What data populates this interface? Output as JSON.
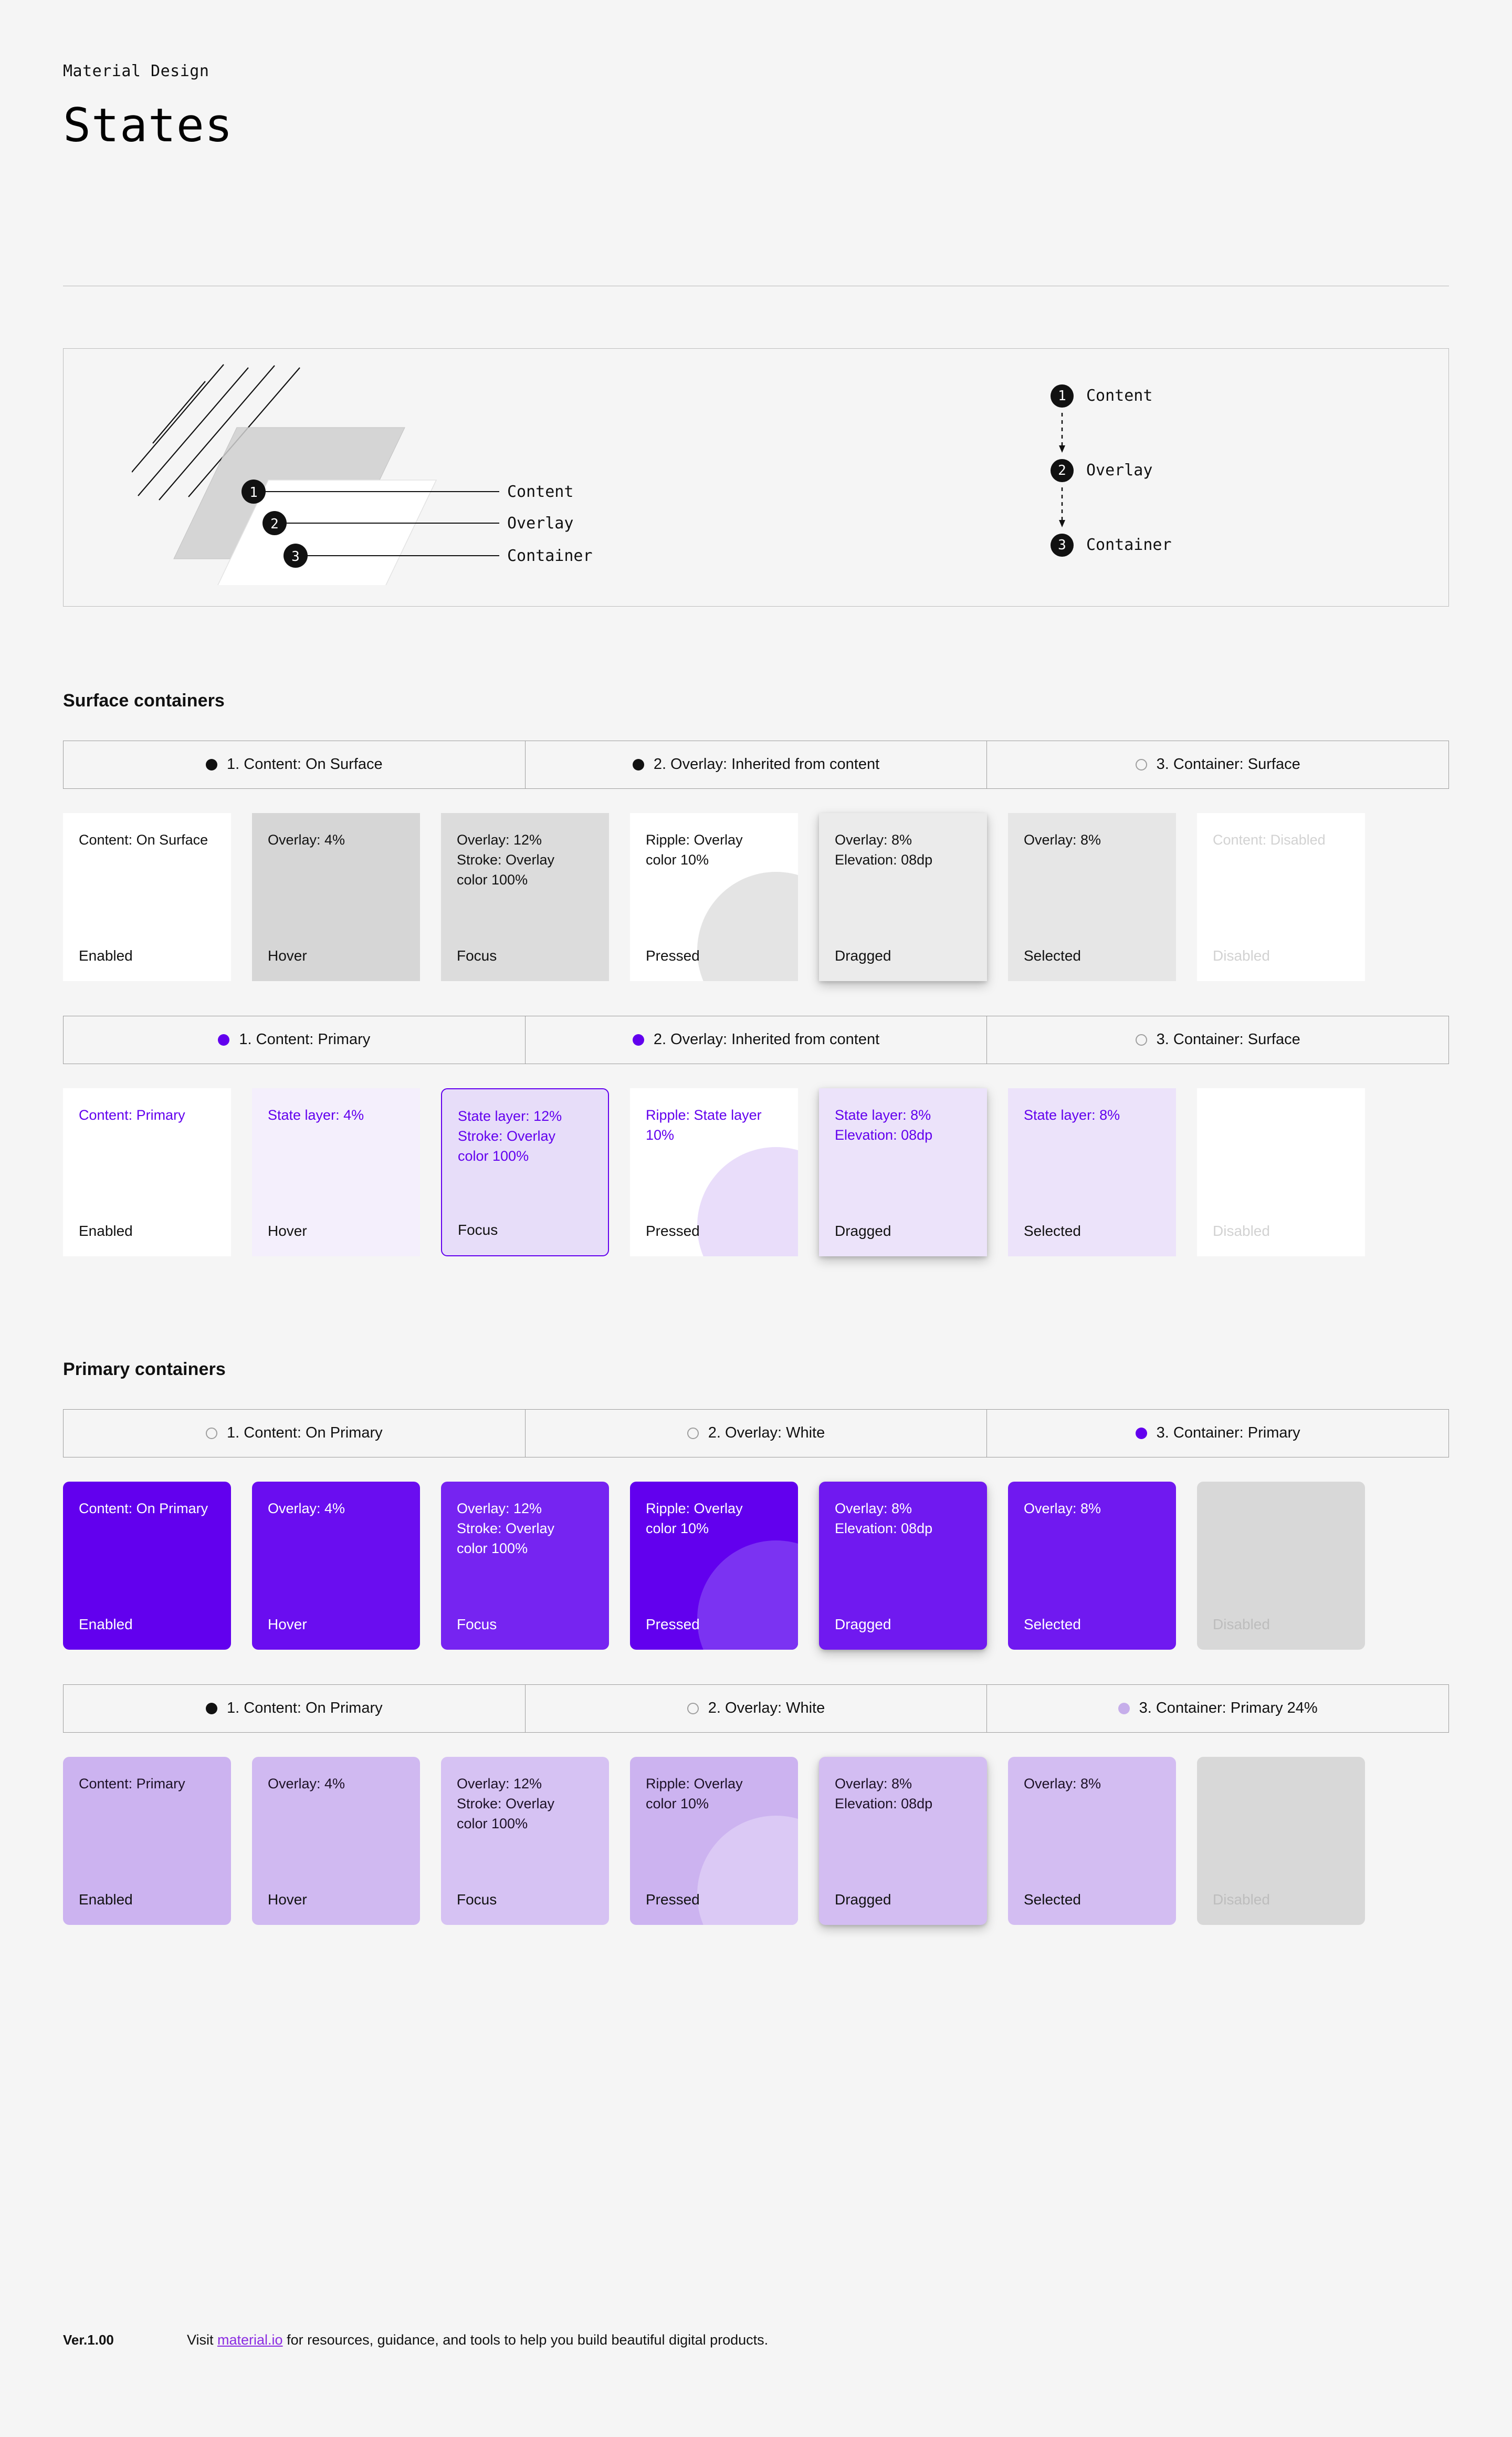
{
  "header": {
    "eyebrow": "Material Design",
    "title": "States"
  },
  "diagram": {
    "callouts": [
      {
        "num": "1",
        "label": "Content"
      },
      {
        "num": "2",
        "label": "Overlay"
      },
      {
        "num": "3",
        "label": "Container"
      }
    ],
    "legend": [
      {
        "num": "1",
        "label": "Content"
      },
      {
        "num": "2",
        "label": "Overlay"
      },
      {
        "num": "3",
        "label": "Container"
      }
    ]
  },
  "colors": {
    "primary": "#6200EE",
    "primary_dot": "#6200EE",
    "primary_24": "#C6AEEA",
    "on_surface_dot": "#111111",
    "hollow_dot_border": "#9e9e9e",
    "link": "#8a2be2"
  },
  "sections": [
    {
      "heading": "Surface containers",
      "rows": [
        {
          "legend": [
            {
              "dot": "filled-black",
              "text": "1. Content: On Surface"
            },
            {
              "dot": "filled-black",
              "text": "2. Overlay: Inherited from content"
            },
            {
              "dot": "hollow",
              "text": "3. Container: Surface"
            }
          ],
          "cards": [
            {
              "desc": "Content: On Surface",
              "state": "Enabled",
              "bg": "#ffffff",
              "text": "#111111",
              "state_text": "#111111"
            },
            {
              "desc": "Overlay: 4%",
              "state": "Hover",
              "bg": "#d6d6d6",
              "text": "#111111",
              "state_text": "#111111"
            },
            {
              "desc": "Overlay: 12%\nStroke: Overlay\ncolor 100%",
              "state": "Focus",
              "bg": "#dcdcdc",
              "text": "#111111",
              "state_text": "#111111"
            },
            {
              "desc": "Ripple: Overlay\ncolor 10%",
              "state": "Pressed",
              "bg": "#ffffff",
              "text": "#111111",
              "state_text": "#111111",
              "ripple": "#e4e4e4"
            },
            {
              "desc": "Overlay: 8%\nElevation: 08dp",
              "state": "Dragged",
              "bg": "#ebebeb",
              "text": "#111111",
              "state_text": "#111111",
              "elevation": true
            },
            {
              "desc": "Overlay: 8%",
              "state": "Selected",
              "bg": "#e6e6e6",
              "text": "#111111",
              "state_text": "#111111"
            },
            {
              "desc": "Content: Disabled",
              "state": "Disabled",
              "bg": "#ffffff",
              "text": "#d2d2d2",
              "state_text": "#d2d2d2"
            }
          ]
        },
        {
          "legend": [
            {
              "dot": "filled-primary",
              "text": "1. Content: Primary"
            },
            {
              "dot": "filled-primary",
              "text": "2. Overlay: Inherited from content"
            },
            {
              "dot": "hollow",
              "text": "3. Container: Surface"
            }
          ],
          "cards": [
            {
              "desc": "Content: Primary",
              "state": "Enabled",
              "bg": "#ffffff",
              "text": "#6200EE",
              "state_text": "#111111"
            },
            {
              "desc": "State layer: 4%",
              "state": "Hover",
              "bg": "#f4effc",
              "text": "#6200EE",
              "state_text": "#111111"
            },
            {
              "desc": "State layer: 12%\nStroke: Overlay\ncolor 100%",
              "state": "Focus",
              "bg": "#e7ddf9",
              "text": "#6200EE",
              "state_text": "#111111",
              "stroke": "#6200EE",
              "rounded": true
            },
            {
              "desc": "Ripple: State layer\n10%",
              "state": "Pressed",
              "bg": "#ffffff",
              "text": "#6200EE",
              "state_text": "#111111",
              "ripple": "#e9ddfa"
            },
            {
              "desc": "State layer: 8%\nElevation: 08dp",
              "state": "Dragged",
              "bg": "#ece3fa",
              "text": "#6200EE",
              "state_text": "#111111",
              "elevation": true
            },
            {
              "desc": "State layer: 8%",
              "state": "Selected",
              "bg": "#ece3fa",
              "text": "#6200EE",
              "state_text": "#111111"
            },
            {
              "desc": "",
              "state": "Disabled",
              "bg": "#ffffff",
              "text": "#d2d2d2",
              "state_text": "#d2d2d2"
            }
          ]
        }
      ]
    },
    {
      "heading": "Primary containers",
      "rows": [
        {
          "legend": [
            {
              "dot": "hollow",
              "text": "1. Content: On Primary"
            },
            {
              "dot": "hollow",
              "text": "2. Overlay: White"
            },
            {
              "dot": "filled-primary",
              "text": "3. Container: Primary"
            }
          ],
          "cards": [
            {
              "desc": "Content: On Primary",
              "state": "Enabled",
              "bg": "#6200EE",
              "text": "#ffffff",
              "state_text": "#ffffff",
              "rounded": true
            },
            {
              "desc": "Overlay: 4%",
              "state": "Hover",
              "bg": "#6a0df0",
              "text": "#ffffff",
              "state_text": "#ffffff",
              "rounded": true
            },
            {
              "desc": "Overlay: 12%\nStroke: Overlay\ncolor 100%",
              "state": "Focus",
              "bg": "#7624f1",
              "text": "#ffffff",
              "state_text": "#ffffff",
              "rounded": true
            },
            {
              "desc": "Ripple: Overlay\ncolor 10%",
              "state": "Pressed",
              "bg": "#6200EE",
              "text": "#ffffff",
              "state_text": "#ffffff",
              "ripple": "#7b33f2",
              "rounded": true
            },
            {
              "desc": "Overlay: 8%\nElevation: 08dp",
              "state": "Dragged",
              "bg": "#7019f0",
              "text": "#ffffff",
              "state_text": "#ffffff",
              "elevation": true,
              "rounded": true
            },
            {
              "desc": "Overlay: 8%",
              "state": "Selected",
              "bg": "#7019f0",
              "text": "#ffffff",
              "state_text": "#ffffff",
              "rounded": true
            },
            {
              "desc": "",
              "state": "Disabled",
              "bg": "#d8d8d8",
              "text": "#bdbdbd",
              "state_text": "#bdbdbd",
              "rounded": true
            }
          ]
        },
        {
          "legend": [
            {
              "dot": "filled-black",
              "text": "1. Content: On Primary"
            },
            {
              "dot": "hollow",
              "text": "2. Overlay: White"
            },
            {
              "dot": "filled-primary24",
              "text": "3. Container: Primary 24%"
            }
          ],
          "cards": [
            {
              "desc": "Content: Primary",
              "state": "Enabled",
              "bg": "#ccb3f0",
              "text": "#1c1126",
              "state_text": "#111111",
              "rounded": true
            },
            {
              "desc": "Overlay: 4%",
              "state": "Hover",
              "bg": "#d0b9f1",
              "text": "#1c1126",
              "state_text": "#111111",
              "rounded": true
            },
            {
              "desc": "Overlay: 12%\nStroke: Overlay\ncolor 100%",
              "state": "Focus",
              "bg": "#d6c2f3",
              "text": "#1c1126",
              "state_text": "#111111",
              "rounded": true
            },
            {
              "desc": "Ripple: Overlay\ncolor 10%",
              "state": "Pressed",
              "bg": "#ccb3f0",
              "text": "#1c1126",
              "state_text": "#111111",
              "ripple": "#dbc9f5",
              "rounded": true
            },
            {
              "desc": "Overlay: 8%\nElevation: 08dp",
              "state": "Dragged",
              "bg": "#d3bdf2",
              "text": "#1c1126",
              "state_text": "#111111",
              "elevation": true,
              "rounded": true
            },
            {
              "desc": "Overlay: 8%",
              "state": "Selected",
              "bg": "#d3bdf2",
              "text": "#1c1126",
              "state_text": "#111111",
              "rounded": true
            },
            {
              "desc": "",
              "state": "Disabled",
              "bg": "#d8d8d8",
              "text": "#bdbdbd",
              "state_text": "#bdbdbd",
              "rounded": true
            }
          ]
        }
      ]
    }
  ],
  "footer": {
    "version": "Ver.1.00",
    "visit_prefix": "Visit ",
    "link": "material.io",
    "visit_suffix": " for resources, guidance, and tools to help you build beautiful digital products."
  }
}
